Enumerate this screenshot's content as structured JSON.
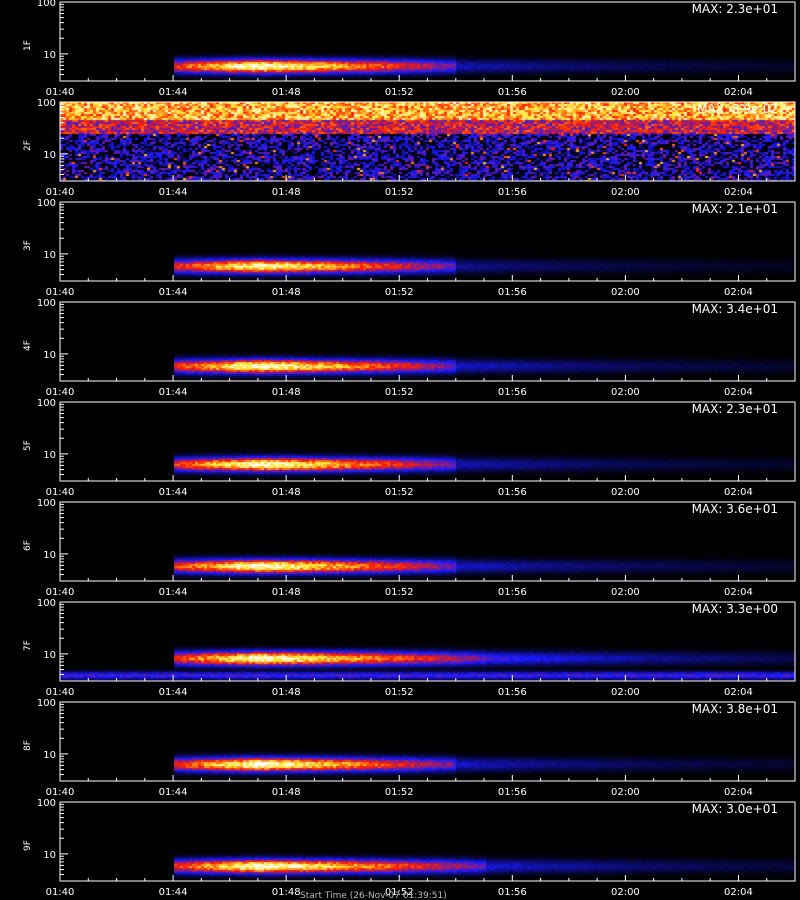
{
  "figure": {
    "bottom_label": "Start Time (26-Nov-07 01:39:51)"
  },
  "colors": {
    "background": "#000000",
    "axis": "#ffffff",
    "colormap": [
      "#000000",
      "#1a1aff",
      "#ff2000",
      "#ffff40",
      "#ffffff"
    ]
  },
  "chart_data": [
    {
      "type": "heatmap",
      "panel_label": "1F",
      "max_label": "MAX: 2.3e+01",
      "max_value": 23,
      "yscale": "log",
      "yticks": [
        "100",
        "10"
      ],
      "x_ticks": [
        "01:40",
        "01:44",
        "01:48",
        "01:52",
        "01:56",
        "02:00",
        "02:04"
      ],
      "xlim": [
        "01:40",
        "02:06"
      ],
      "ylim": [
        3,
        100
      ],
      "features": [
        {
          "kind": "burst",
          "start": "01:44",
          "peak": "01:47",
          "end": "01:54",
          "y_center": 6,
          "intensity": 1.0,
          "tail": 0.18
        }
      ]
    },
    {
      "type": "heatmap",
      "panel_label": "2F",
      "max_label": "MAX: 8.9e-02",
      "max_value": 0.089,
      "yscale": "log",
      "yticks": [
        "100",
        "10"
      ],
      "x_ticks": [
        "01:40",
        "01:44",
        "01:48",
        "01:52",
        "01:56",
        "02:00",
        "02:04"
      ],
      "xlim": [
        "01:40",
        "02:06"
      ],
      "ylim": [
        3,
        100
      ],
      "features": [
        {
          "kind": "noise",
          "bright_band": [
            45,
            100
          ],
          "mid_band": [
            25,
            45
          ],
          "low_band": [
            3,
            25
          ]
        }
      ]
    },
    {
      "type": "heatmap",
      "panel_label": "3F",
      "max_label": "MAX: 2.1e+01",
      "max_value": 21,
      "yscale": "log",
      "yticks": [
        "100",
        "10"
      ],
      "x_ticks": [
        "01:40",
        "01:44",
        "01:48",
        "01:52",
        "01:56",
        "02:00",
        "02:04"
      ],
      "xlim": [
        "01:40",
        "02:06"
      ],
      "ylim": [
        3,
        100
      ],
      "features": [
        {
          "kind": "burst",
          "start": "01:44",
          "peak": "01:47",
          "end": "01:54",
          "y_center": 6,
          "intensity": 0.95,
          "tail": 0.15
        }
      ]
    },
    {
      "type": "heatmap",
      "panel_label": "4F",
      "max_label": "MAX: 3.4e+01",
      "max_value": 34,
      "yscale": "log",
      "yticks": [
        "100",
        "10"
      ],
      "x_ticks": [
        "01:40",
        "01:44",
        "01:48",
        "01:52",
        "01:56",
        "02:00",
        "02:04"
      ],
      "xlim": [
        "01:40",
        "02:06"
      ],
      "ylim": [
        3,
        100
      ],
      "features": [
        {
          "kind": "burst",
          "start": "01:44",
          "peak": "01:47",
          "end": "01:54",
          "y_center": 6,
          "intensity": 1.0,
          "tail": 0.2
        }
      ]
    },
    {
      "type": "heatmap",
      "panel_label": "5F",
      "max_label": "MAX: 2.3e+01",
      "max_value": 23,
      "yscale": "log",
      "yticks": [
        "100",
        "10"
      ],
      "x_ticks": [
        "01:40",
        "01:44",
        "01:48",
        "01:52",
        "01:56",
        "02:00",
        "02:04"
      ],
      "xlim": [
        "01:40",
        "02:06"
      ],
      "ylim": [
        3,
        100
      ],
      "features": [
        {
          "kind": "burst",
          "start": "01:44",
          "peak": "01:47",
          "end": "01:54",
          "y_center": 6.5,
          "intensity": 1.0,
          "tail": 0.18
        }
      ]
    },
    {
      "type": "heatmap",
      "panel_label": "6F",
      "max_label": "MAX: 3.6e+01",
      "max_value": 36,
      "yscale": "log",
      "yticks": [
        "100",
        "10"
      ],
      "x_ticks": [
        "01:40",
        "01:44",
        "01:48",
        "01:52",
        "01:56",
        "02:00",
        "02:04"
      ],
      "xlim": [
        "01:40",
        "02:06"
      ],
      "ylim": [
        3,
        100
      ],
      "features": [
        {
          "kind": "burst",
          "start": "01:44",
          "peak": "01:47",
          "end": "01:54",
          "y_center": 6,
          "intensity": 1.0,
          "tail": 0.2
        }
      ]
    },
    {
      "type": "heatmap",
      "panel_label": "7F",
      "max_label": "MAX: 3.3e+00",
      "max_value": 3.3,
      "yscale": "log",
      "yticks": [
        "100",
        "10"
      ],
      "x_ticks": [
        "01:40",
        "01:44",
        "01:48",
        "01:52",
        "01:56",
        "02:00",
        "02:04"
      ],
      "xlim": [
        "01:40",
        "02:06"
      ],
      "ylim": [
        3,
        100
      ],
      "features": [
        {
          "kind": "burst",
          "start": "01:44",
          "peak": "01:47",
          "end": "01:55",
          "y_center": 8.5,
          "intensity": 1.0,
          "tail": 0.3
        },
        {
          "kind": "floor",
          "y_center": 4,
          "intensity": 0.3
        }
      ]
    },
    {
      "type": "heatmap",
      "panel_label": "8F",
      "max_label": "MAX: 3.8e+01",
      "max_value": 38,
      "yscale": "log",
      "yticks": [
        "100",
        "10"
      ],
      "x_ticks": [
        "01:40",
        "01:44",
        "01:48",
        "01:52",
        "01:56",
        "02:00",
        "02:04"
      ],
      "xlim": [
        "01:40",
        "02:06"
      ],
      "ylim": [
        3,
        100
      ],
      "features": [
        {
          "kind": "burst",
          "start": "01:44",
          "peak": "01:47",
          "end": "01:54",
          "y_center": 6.5,
          "intensity": 1.0,
          "tail": 0.2
        }
      ]
    },
    {
      "type": "heatmap",
      "panel_label": "9F",
      "max_label": "MAX: 3.0e+01",
      "max_value": 30,
      "yscale": "log",
      "yticks": [
        "100",
        "10"
      ],
      "x_ticks": [
        "01:40",
        "01:44",
        "01:48",
        "01:52",
        "01:56",
        "02:00",
        "02:04"
      ],
      "xlim": [
        "01:40",
        "02:06"
      ],
      "ylim": [
        3,
        100
      ],
      "features": [
        {
          "kind": "burst",
          "start": "01:44",
          "peak": "01:47",
          "end": "01:55",
          "y_center": 6,
          "intensity": 1.0,
          "tail": 0.22
        }
      ]
    }
  ]
}
